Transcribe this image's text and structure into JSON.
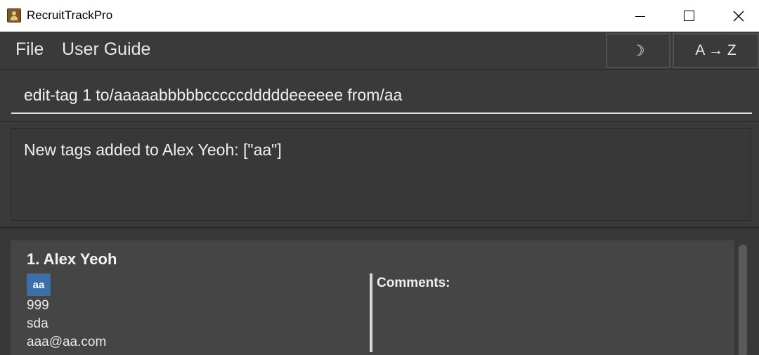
{
  "window": {
    "title": "RecruitTrackPro",
    "controls": {
      "minimize": "minimize",
      "maximize": "maximize",
      "close": "close"
    }
  },
  "menu": {
    "file": "File",
    "user_guide": "User Guide"
  },
  "toolbar": {
    "theme_toggle": "☽",
    "sort": "A → Z"
  },
  "command": {
    "value": "edit-tag 1 to/aaaaabbbbbcccccdddddeeeeee from/aa"
  },
  "result": {
    "message": "New tags added to Alex Yeoh: [\"aa\"]"
  },
  "persons": [
    {
      "index_name": "1. Alex Yeoh",
      "tags": [
        "aa"
      ],
      "phone": "999",
      "address": "sda",
      "email": "aaa@aa.com",
      "comments_label": "Comments:"
    }
  ],
  "colors": {
    "background": "#3a3a3a",
    "card": "#454545",
    "tag": "#3e6ea8",
    "text": "#f0f0f0"
  }
}
